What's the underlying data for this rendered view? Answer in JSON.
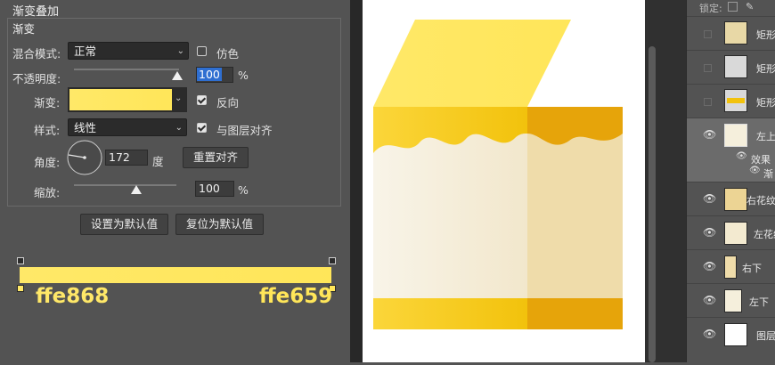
{
  "dialog": {
    "section_title": "渐变叠加",
    "group_title": "渐变",
    "blend_mode_label": "混合模式:",
    "blend_mode_value": "正常",
    "dither_label": "仿色",
    "opacity_label": "不透明度:",
    "opacity_value": "100",
    "opacity_unit": "%",
    "opacity_level": 1.0,
    "gradient_label": "渐变:",
    "reverse_label": "反向",
    "style_label": "样式:",
    "style_value": "线性",
    "align_label": "与图层对齐",
    "angle_label": "角度:",
    "angle_value": "172",
    "angle_unit": "度",
    "reset_align_button": "重置对齐",
    "scale_label": "缩放:",
    "scale_value": "100",
    "scale_unit": "%",
    "scale_level": 0.6,
    "set_default_button": "设置为默认值",
    "reset_default_button": "复位为默认值",
    "dither_checked": false,
    "reverse_checked": true,
    "align_checked": true
  },
  "gradient_editor": {
    "left_color_label": "ffe868",
    "right_color_label": "ffe659",
    "left_color": "#ffe868",
    "right_color": "#ffe659"
  },
  "layers_panel": {
    "lock_label": "锁定:",
    "layers": [
      {
        "name": "矩形",
        "visible": false
      },
      {
        "name": "矩形",
        "visible": false
      },
      {
        "name": "矩形",
        "visible": false
      },
      {
        "name": "左上",
        "visible": true,
        "selected": true
      },
      {
        "name": "效果",
        "sub": true
      },
      {
        "name": "渐",
        "sub": true
      },
      {
        "name": "右花纹",
        "visible": true
      },
      {
        "name": "左花纹",
        "visible": true
      },
      {
        "name": "右下",
        "visible": true
      },
      {
        "name": "左下",
        "visible": true
      },
      {
        "name": "图层",
        "visible": true
      }
    ]
  },
  "icons": [
    "chevron-down-icon",
    "eye-icon",
    "checkbox-icon",
    "angle-dial-icon",
    "color-stop-icon",
    "lock-icon"
  ]
}
